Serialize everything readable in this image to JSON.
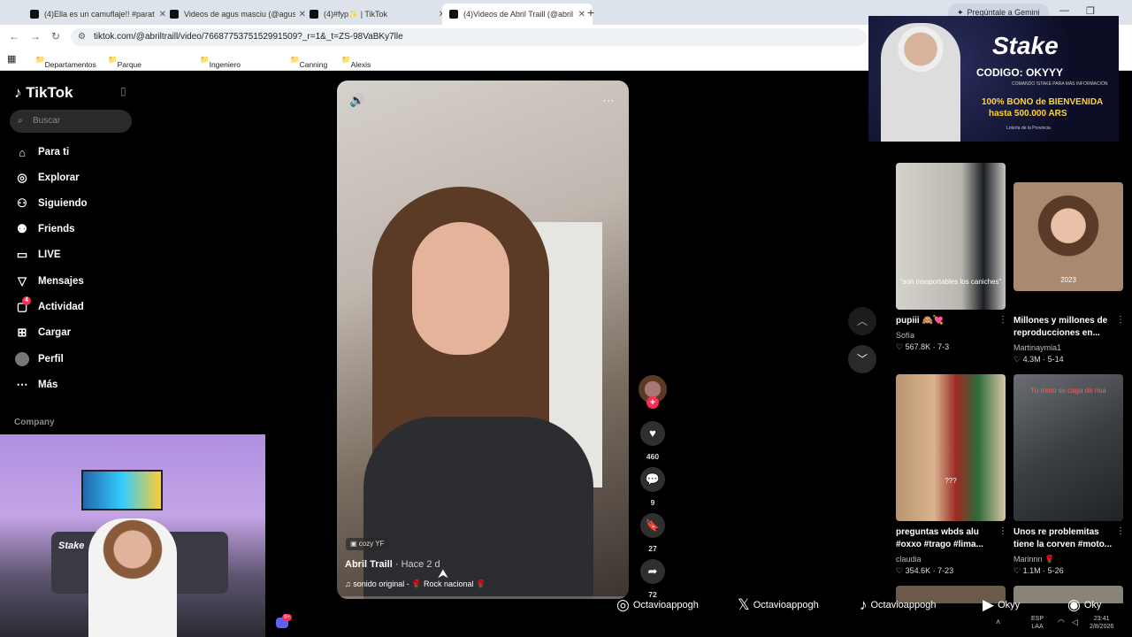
{
  "browser": {
    "tabs": [
      {
        "title": "(4)Ella es un camuflaje!! #parat"
      },
      {
        "title": "Videos de agus masciu (@agus"
      },
      {
        "title": "(4)#fyp✨ | TikTok"
      },
      {
        "title": "(4)Videos de Abril Traill (@abril"
      }
    ],
    "gemini_label": "Pregúntale a Gemini",
    "url": "tiktok.com/@abriltraill/video/7668775375152991509?_r=1&_t=ZS-98VaBKy7lle",
    "bookmarks": [
      "Departamentos",
      "Parque Leloir - Zon...",
      "Ingeniero Maschti...",
      "Canning",
      "Alexis"
    ]
  },
  "sidebar": {
    "logo": "TikTok",
    "search_placeholder": "Buscar",
    "items": [
      {
        "label": "Para ti",
        "icon": "home-icon"
      },
      {
        "label": "Explorar",
        "icon": "compass-icon"
      },
      {
        "label": "Siguiendo",
        "icon": "following-icon"
      },
      {
        "label": "Friends",
        "icon": "friends-icon"
      },
      {
        "label": "LIVE",
        "icon": "live-icon"
      },
      {
        "label": "Mensajes",
        "icon": "messages-icon"
      },
      {
        "label": "Actividad",
        "icon": "activity-icon",
        "badge": "4"
      },
      {
        "label": "Cargar",
        "icon": "upload-icon"
      },
      {
        "label": "Perfil",
        "icon": "profile-avatar"
      },
      {
        "label": "Más",
        "icon": "more-icon"
      }
    ],
    "company_label": "Company"
  },
  "webcam": {
    "brand": "Stake"
  },
  "video": {
    "badge": "cozy YF",
    "author": "Abril Traill",
    "posted": "· Hace 2 d",
    "sound": "sonido original - 🌹 Rock nacional 🌹",
    "likes": "460",
    "comments": "9",
    "saves": "27",
    "shares": "72"
  },
  "ad": {
    "brand": "Stake",
    "code": "CODIGO: OKYYY",
    "small1": "COMANDO !STAKE PARA MÁS INFORMACIÓN",
    "bono": "100% BONO de BIENVENIDA",
    "hasta": "hasta 500.000 ARS",
    "lottery": "Lotería de la Provincia"
  },
  "grid": [
    {
      "caption": "\"son insoportables los caniches\"",
      "title": "pupiii 🙈💘",
      "user": "Sofía",
      "stats": "♡ 567.8K · 7-3",
      "bg": "#c9c6c0"
    },
    {
      "caption": "2023",
      "title": "Millones y millones de reproducciones en...",
      "user": "Martinaymia1",
      "stats": "♡ 4.3M · 5-14",
      "bg": "#a9876e"
    },
    {
      "caption": "???",
      "title": "preguntas wbds alu #oxxo #trago #lima...",
      "user": "claudia",
      "stats": "♡ 354.6K · 7-23",
      "bg": "#b48c6e"
    },
    {
      "caption": "Tu moto se caga de risa",
      "title": "Unos re problemitas tiene la corven #moto...",
      "user": "Marinnn 🌹",
      "stats": "♡ 1.1M · 5-26",
      "bg": "#4a4d50"
    }
  ],
  "socials": [
    {
      "icon": "instagram-icon",
      "glyph": "◎",
      "handle": "Octavioappogh"
    },
    {
      "icon": "x-icon",
      "glyph": "𝕏",
      "handle": "Octavioappogh"
    },
    {
      "icon": "tiktok-icon",
      "glyph": "♪",
      "handle": "Octavioappogh"
    },
    {
      "icon": "youtube-icon",
      "glyph": "▶",
      "handle": "Okyy"
    },
    {
      "icon": "spotify-icon",
      "glyph": "◉",
      "handle": "Oky"
    }
  ],
  "taskbar": {
    "lang": "ESP",
    "region": "LAA",
    "time": "23:41",
    "date": "2/8/2026",
    "discord_badge": "9+"
  },
  "colors": {
    "accent": "#fe2c55",
    "gemini": "#cdd6e0"
  }
}
